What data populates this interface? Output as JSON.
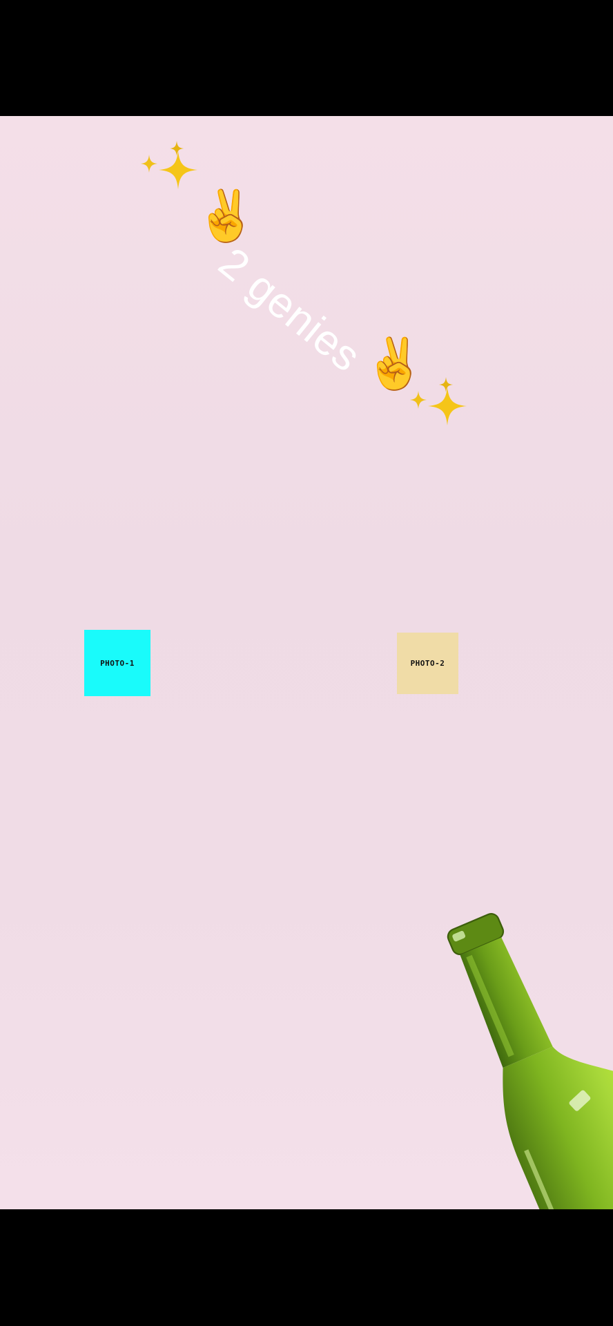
{
  "caption": {
    "text": "2 genies",
    "emoji": "✌️"
  },
  "icons": {
    "sparkles": "sparkles-icon",
    "peace": "victory-hand-icon",
    "bottle": "wine-bottle-icon"
  },
  "photos": [
    {
      "label": "PHOTO-1",
      "color": "#19fbfb"
    },
    {
      "label": "PHOTO-2",
      "color": "#f0dca7"
    }
  ],
  "colors": {
    "background": "#f0dce6",
    "caption_text": "#ffffff",
    "bottle_green": "#8bc220"
  }
}
